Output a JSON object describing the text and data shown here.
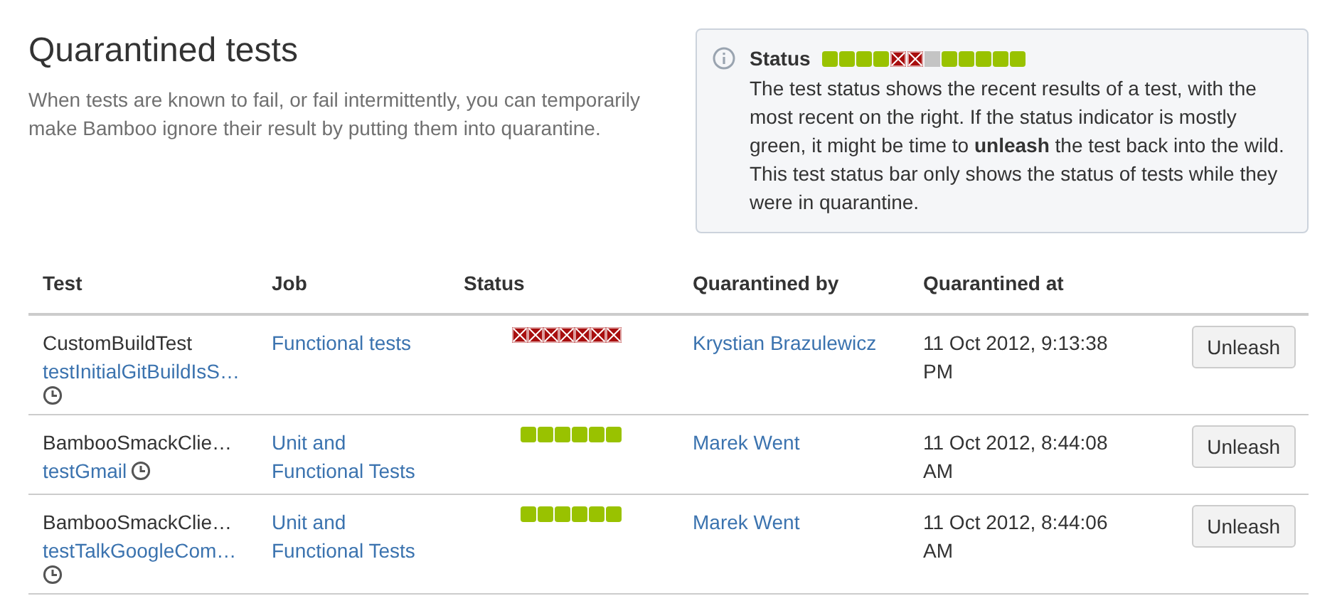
{
  "title": "Quarantined tests",
  "description": "When tests are known to fail, or fail intermittently, you can temporarily make Bamboo ignore their result by putting them into quarantine.",
  "info_box": {
    "heading": "Status",
    "legend": [
      {
        "kind": "pass"
      },
      {
        "kind": "pass"
      },
      {
        "kind": "pass"
      },
      {
        "kind": "pass"
      },
      {
        "kind": "fail"
      },
      {
        "kind": "fail"
      },
      {
        "kind": "unknown"
      },
      {
        "kind": "pass"
      },
      {
        "kind": "pass"
      },
      {
        "kind": "pass"
      },
      {
        "kind": "pass"
      },
      {
        "kind": "pass"
      }
    ],
    "text": "The test status shows the recent results of a test, with the most recent on the right. If the status indicator is mostly green, it might be time to **unleash** the test back into the wild. This test status bar only shows the status of tests while they were in quarantine."
  },
  "table": {
    "columns": [
      "Test",
      "Job",
      "Status",
      "Quarantined by",
      "Quarantined at"
    ],
    "rows": [
      {
        "test_class": "CustomBuildTest",
        "test_method": "testInitialGitBuildIsS…",
        "job": "Functional tests",
        "status": [
          {
            "kind": "fail"
          },
          {
            "kind": "fail"
          },
          {
            "kind": "fail"
          },
          {
            "kind": "fail"
          },
          {
            "kind": "fail"
          },
          {
            "kind": "fail"
          },
          {
            "kind": "fail"
          }
        ],
        "quarantined_by": "Krystian Brazulewicz",
        "quarantined_at": "11 Oct 2012, 9:13:38 PM",
        "action": "Unleash"
      },
      {
        "test_class": "BambooSmackClie…",
        "test_method": "testGmail",
        "job": "Unit and Functional Tests",
        "status": [
          {
            "kind": "pass"
          },
          {
            "kind": "pass"
          },
          {
            "kind": "pass"
          },
          {
            "kind": "pass"
          },
          {
            "kind": "pass"
          },
          {
            "kind": "pass"
          }
        ],
        "quarantined_by": "Marek Went",
        "quarantined_at": "11 Oct 2012, 8:44:08 AM",
        "action": "Unleash"
      },
      {
        "test_class": "BambooSmackClie…",
        "test_method": "testTalkGoogleCom…",
        "job": "Unit and Functional Tests",
        "status": [
          {
            "kind": "pass"
          },
          {
            "kind": "pass"
          },
          {
            "kind": "pass"
          },
          {
            "kind": "pass"
          },
          {
            "kind": "pass"
          },
          {
            "kind": "pass"
          }
        ],
        "quarantined_by": "Marek Went",
        "quarantined_at": "11 Oct 2012, 8:44:06 AM",
        "action": "Unleash"
      }
    ]
  }
}
